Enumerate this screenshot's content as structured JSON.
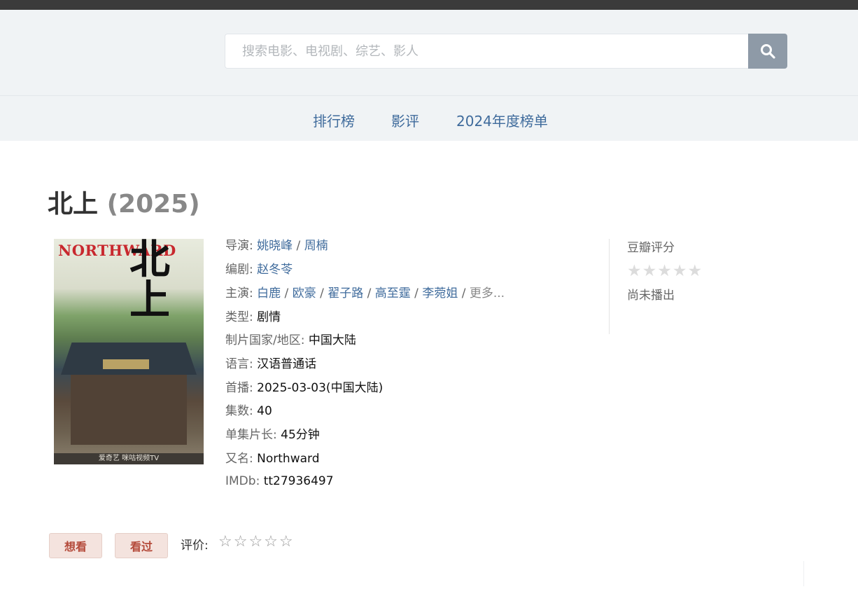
{
  "search": {
    "placeholder": "搜索电影、电视剧、综艺、影人"
  },
  "nav": {
    "items": [
      "排行榜",
      "影评",
      "2024年度榜单"
    ]
  },
  "title": {
    "name": "北上",
    "year": "(2025)"
  },
  "poster": {
    "title_en": "NORTHWARD",
    "title_cn": "北上",
    "footer": "爱奇艺 咪咕视频TV"
  },
  "details": {
    "director_label": "导演",
    "directors": [
      "姚晓峰",
      "周楠"
    ],
    "writer_label": "编剧",
    "writers": [
      "赵冬苓"
    ],
    "cast_label": "主演",
    "cast": [
      "白鹿",
      "欧豪",
      "翟子路",
      "高至霆",
      "李菀姐"
    ],
    "cast_more": "更多...",
    "genre_label": "类型:",
    "genre": "剧情",
    "country_label": "制片国家/地区:",
    "country": "中国大陆",
    "language_label": "语言:",
    "language": "汉语普通话",
    "premiere_label": "首播:",
    "premiere": "2025-03-03(中国大陆)",
    "episodes_label": "集数:",
    "episodes": "40",
    "runtime_label": "单集片长:",
    "runtime": "45分钟",
    "aka_label": "又名:",
    "aka": "Northward",
    "imdb_label": "IMDb:",
    "imdb": "tt27936497"
  },
  "rating": {
    "label": "豆瓣评分",
    "stars": "★★★★★",
    "status": "尚未播出"
  },
  "actions": {
    "want_label": "想看",
    "seen_label": "看过",
    "rate_label": "评价:",
    "stars_empty": "☆☆☆☆☆"
  }
}
